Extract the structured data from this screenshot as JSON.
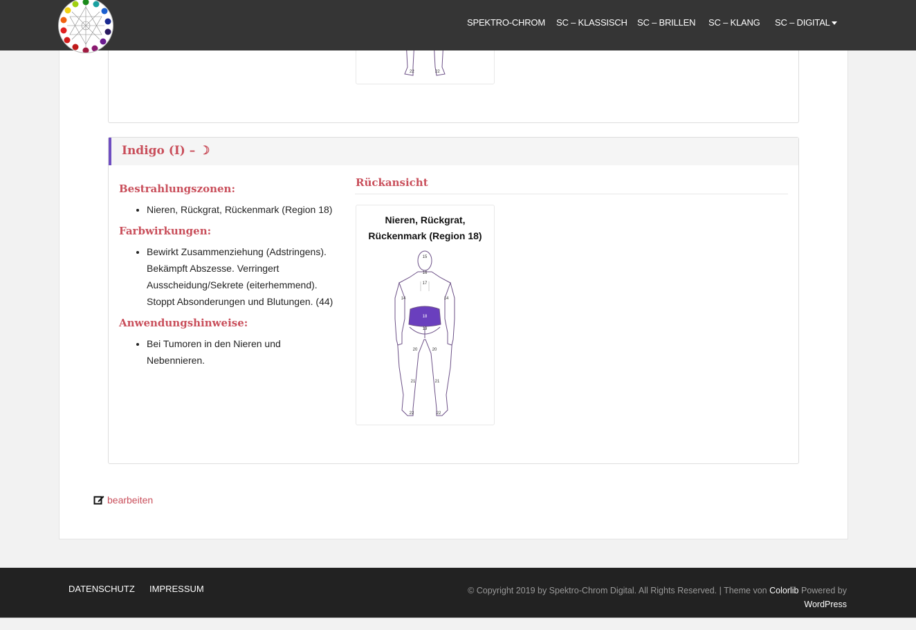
{
  "nav": {
    "items": [
      "SPEKTRO-CHROM",
      "SC – KLASSISCH",
      "SC – BRILLEN",
      "SC – KLANG",
      "SC – DIGITAL"
    ]
  },
  "card": {
    "title": "Indigo (I) – ☽",
    "bestrahlung_heading": "Bestrahlungszonen:",
    "bestrahlung_items": [
      "Nieren, Rückgrat, Rückenmark (Region 18)"
    ],
    "farb_heading": "Farbwirkungen:",
    "farb_items": [
      "Bewirkt Zusammenziehung (Adstringens). Bekämpft Abszesse. Verringert Ausscheidung/Sekrete (eiterhemmend). Stoppt Absonderungen und Blutungen. (44)"
    ],
    "anwendung_heading": "Anwendungshinweise:",
    "anwendung_items": [
      "Bei Tumoren in den Nieren und Nebennieren."
    ],
    "view_heading": "Rückansicht",
    "figure": {
      "title": "Nieren, Rückgrat, Rückenmark (Region 18)",
      "labels": {
        "head": "15",
        "neck": "16",
        "upper": "17",
        "arm_l": "14",
        "arm_r": "14",
        "mid": "18",
        "hips": "19",
        "thigh_l": "20",
        "thigh_r": "20",
        "calf_l": "21",
        "calf_r": "21",
        "foot_l": "22",
        "foot_r": "22"
      },
      "highlight_color": "#6a3fbe"
    }
  },
  "edit_label": "bearbeiten",
  "footer": {
    "links": [
      "DATENSCHUTZ",
      "IMPRESSUM"
    ],
    "copyright": "© Copyright 2019 by Spektro-Chrom Digital. All Rights Reserved. | Theme von",
    "colorlib": "Colorlib",
    "powered": "Powered by",
    "wordpress": "WordPress"
  }
}
